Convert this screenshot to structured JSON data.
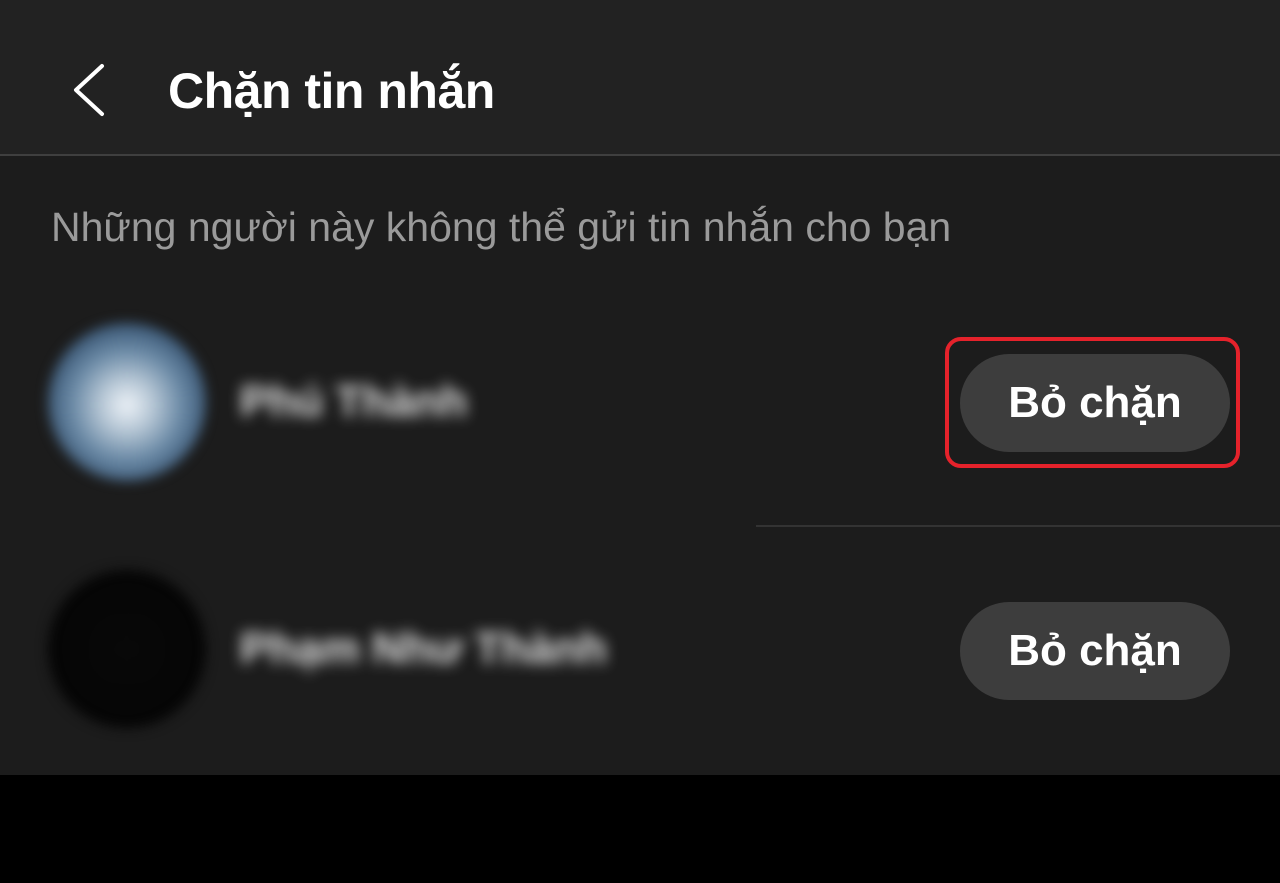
{
  "header": {
    "title": "Chặn tin nhắn",
    "back_icon": "chevron-left-icon"
  },
  "subtitle": "Những người này không thể gửi tin nhắn cho bạn",
  "blocked_users": [
    {
      "name": "Phú Thành",
      "action_label": "Bỏ chặn"
    },
    {
      "name": "Phạm Như Thành",
      "action_label": "Bỏ chặn"
    }
  ],
  "colors": {
    "background": "#1c1c1c",
    "header_background": "#222222",
    "button_background": "#3d3d3d",
    "highlight_border": "#e5222b",
    "subtitle_text": "#9a9a9a"
  }
}
